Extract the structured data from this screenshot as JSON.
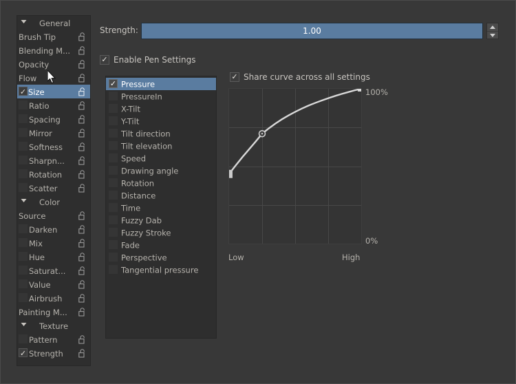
{
  "window": {
    "bg": "#383838",
    "accent": "#5a7ca0"
  },
  "sidebar": {
    "items": [
      {
        "label": "General",
        "type": "header",
        "check": "none",
        "lock": false,
        "selected": false
      },
      {
        "label": "Brush Tip",
        "type": "item",
        "check": "none",
        "lock": true,
        "selected": false,
        "indent": false
      },
      {
        "label": "Blending M...",
        "type": "item",
        "check": "none",
        "lock": true,
        "selected": false,
        "indent": false
      },
      {
        "label": "Opacity",
        "type": "item",
        "check": "none",
        "lock": true,
        "selected": false,
        "indent": false
      },
      {
        "label": "Flow",
        "type": "item",
        "check": "none",
        "lock": true,
        "selected": false,
        "indent": false
      },
      {
        "label": "Size",
        "type": "item",
        "check": "on",
        "lock": true,
        "selected": true,
        "indent": false
      },
      {
        "label": "Ratio",
        "type": "item",
        "check": "off",
        "lock": true,
        "selected": false,
        "indent": true
      },
      {
        "label": "Spacing",
        "type": "item",
        "check": "off",
        "lock": true,
        "selected": false,
        "indent": true
      },
      {
        "label": "Mirror",
        "type": "item",
        "check": "off",
        "lock": true,
        "selected": false,
        "indent": true
      },
      {
        "label": "Softness",
        "type": "item",
        "check": "off",
        "lock": true,
        "selected": false,
        "indent": true
      },
      {
        "label": "Sharpn...",
        "type": "item",
        "check": "off",
        "lock": true,
        "selected": false,
        "indent": true
      },
      {
        "label": "Rotation",
        "type": "item",
        "check": "off",
        "lock": true,
        "selected": false,
        "indent": true
      },
      {
        "label": "Scatter",
        "type": "item",
        "check": "off",
        "lock": true,
        "selected": false,
        "indent": true
      },
      {
        "label": "Color",
        "type": "header",
        "check": "none",
        "lock": false,
        "selected": false
      },
      {
        "label": "Source",
        "type": "item",
        "check": "none",
        "lock": true,
        "selected": false,
        "indent": false
      },
      {
        "label": "Darken",
        "type": "item",
        "check": "off",
        "lock": true,
        "selected": false,
        "indent": true
      },
      {
        "label": "Mix",
        "type": "item",
        "check": "off",
        "lock": true,
        "selected": false,
        "indent": true
      },
      {
        "label": "Hue",
        "type": "item",
        "check": "off",
        "lock": true,
        "selected": false,
        "indent": true
      },
      {
        "label": "Saturat...",
        "type": "item",
        "check": "off",
        "lock": true,
        "selected": false,
        "indent": true
      },
      {
        "label": "Value",
        "type": "item",
        "check": "off",
        "lock": true,
        "selected": false,
        "indent": true
      },
      {
        "label": "Airbrush",
        "type": "item",
        "check": "off",
        "lock": true,
        "selected": false,
        "indent": true
      },
      {
        "label": "Painting M...",
        "type": "item",
        "check": "none",
        "lock": true,
        "selected": false,
        "indent": false
      },
      {
        "label": "Texture",
        "type": "header",
        "check": "none",
        "lock": false,
        "selected": false
      },
      {
        "label": "Pattern",
        "type": "item",
        "check": "off",
        "lock": true,
        "selected": false,
        "indent": true
      },
      {
        "label": "Strength",
        "type": "item",
        "check": "on",
        "lock": true,
        "selected": false,
        "indent": true
      }
    ]
  },
  "strength": {
    "label": "Strength:",
    "value": "1.00",
    "fill_percent": 100
  },
  "pen_settings": {
    "label": "Enable Pen Settings",
    "checked": true,
    "check_glyph": "✓"
  },
  "sensors": {
    "items": [
      {
        "label": "Pressure",
        "checked": true,
        "selected": true
      },
      {
        "label": "PressureIn",
        "checked": false,
        "selected": false
      },
      {
        "label": "X-Tilt",
        "checked": false,
        "selected": false
      },
      {
        "label": "Y-Tilt",
        "checked": false,
        "selected": false
      },
      {
        "label": "Tilt direction",
        "checked": false,
        "selected": false
      },
      {
        "label": "Tilt elevation",
        "checked": false,
        "selected": false
      },
      {
        "label": "Speed",
        "checked": false,
        "selected": false
      },
      {
        "label": "Drawing angle",
        "checked": false,
        "selected": false
      },
      {
        "label": "Rotation",
        "checked": false,
        "selected": false
      },
      {
        "label": "Distance",
        "checked": false,
        "selected": false
      },
      {
        "label": "Time",
        "checked": false,
        "selected": false
      },
      {
        "label": "Fuzzy Dab",
        "checked": false,
        "selected": false
      },
      {
        "label": "Fuzzy Stroke",
        "checked": false,
        "selected": false
      },
      {
        "label": "Fade",
        "checked": false,
        "selected": false
      },
      {
        "label": "Perspective",
        "checked": false,
        "selected": false
      },
      {
        "label": "Tangential pressure",
        "checked": false,
        "selected": false
      }
    ]
  },
  "share_curve": {
    "label": "Share curve across all settings",
    "checked": true
  },
  "chart_data": {
    "type": "line",
    "title": "",
    "xlabel": "",
    "ylabel": "",
    "xlim": [
      0,
      1
    ],
    "ylim": [
      0,
      1
    ],
    "grid": true,
    "grid_divisions_x": 4,
    "grid_divisions_y": 4,
    "x_tick_labels": [
      "Low",
      "High"
    ],
    "y_tick_labels": [
      "100%",
      "0%"
    ],
    "legend": null,
    "series": [
      {
        "name": "Pressure response curve",
        "control_points": [
          [
            0.0,
            0.45
          ],
          [
            0.25,
            0.71
          ],
          [
            1.0,
            1.0
          ]
        ],
        "x": [
          0.0,
          0.05,
          0.1,
          0.15,
          0.2,
          0.25,
          0.3,
          0.35,
          0.4,
          0.45,
          0.5,
          0.55,
          0.6,
          0.65,
          0.7,
          0.75,
          0.8,
          0.85,
          0.9,
          0.95,
          1.0
        ],
        "y": [
          0.45,
          0.505,
          0.558,
          0.608,
          0.658,
          0.71,
          0.744,
          0.775,
          0.803,
          0.828,
          0.851,
          0.872,
          0.891,
          0.908,
          0.924,
          0.939,
          0.953,
          0.966,
          0.978,
          0.99,
          1.0
        ]
      }
    ]
  }
}
